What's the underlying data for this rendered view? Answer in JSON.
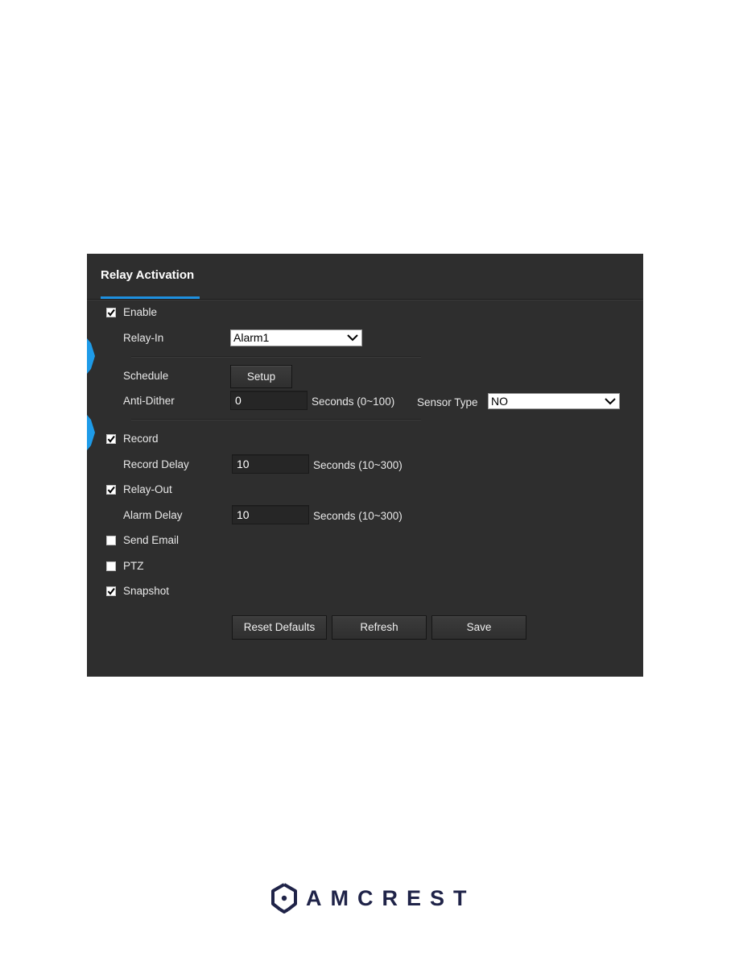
{
  "panel": {
    "title": "Relay Activation",
    "accent_color": "#1e90e0",
    "enable": {
      "label": "Enable",
      "checked": true
    },
    "relay_in": {
      "label": "Relay-In",
      "value": "Alarm1"
    },
    "schedule": {
      "label": "Schedule",
      "button_label": "Setup"
    },
    "anti_dither": {
      "label": "Anti-Dither",
      "value": "0",
      "unit": "Seconds (0~100)"
    },
    "sensor_type": {
      "label": "Sensor Type",
      "value": "NO"
    },
    "record": {
      "label": "Record",
      "checked": true
    },
    "record_delay": {
      "label": "Record Delay",
      "value": "10",
      "unit": "Seconds (10~300)"
    },
    "relay_out": {
      "label": "Relay-Out",
      "checked": true
    },
    "alarm_delay": {
      "label": "Alarm Delay",
      "value": "10",
      "unit": "Seconds (10~300)"
    },
    "send_email": {
      "label": "Send Email",
      "checked": false
    },
    "ptz": {
      "label": "PTZ",
      "checked": false
    },
    "snapshot": {
      "label": "Snapshot",
      "checked": true
    },
    "buttons": {
      "reset_defaults": "Reset Defaults",
      "refresh": "Refresh",
      "save": "Save"
    }
  },
  "footer": {
    "brand": "AMCREST",
    "brand_color": "#1f2348"
  }
}
